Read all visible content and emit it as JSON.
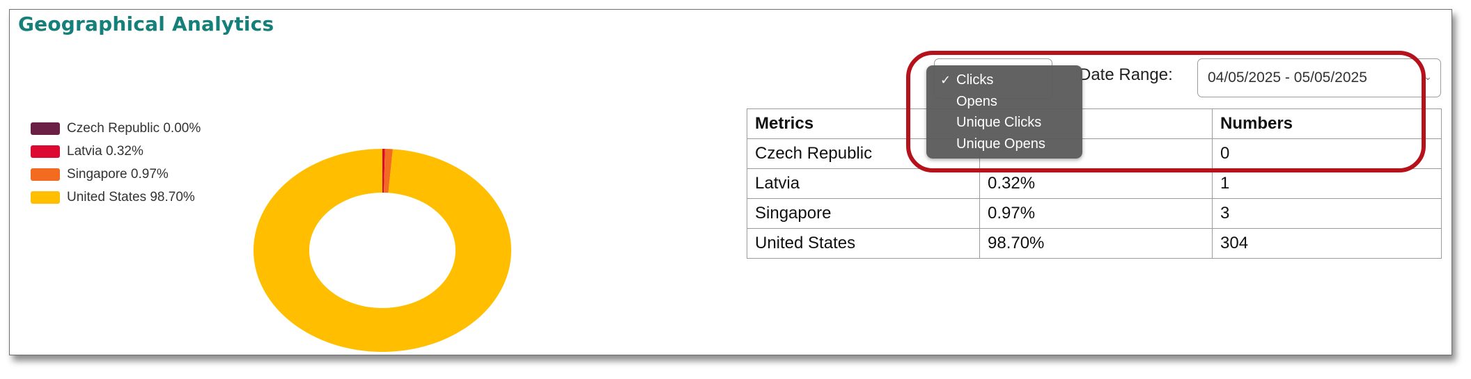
{
  "title": "Geographical Analytics",
  "legend": [
    {
      "label": "Czech Republic 0.00%",
      "color": "#6b1f45"
    },
    {
      "label": "Latvia 0.32%",
      "color": "#dc0a33"
    },
    {
      "label": "Singapore 0.97%",
      "color": "#f26b21"
    },
    {
      "label": "United States 98.70%",
      "color": "#ffbf00"
    }
  ],
  "chart_data": {
    "type": "pie",
    "categories": [
      "Czech Republic",
      "Latvia",
      "Singapore",
      "United States"
    ],
    "values": [
      0.0,
      0.32,
      0.97,
      98.7
    ],
    "colors": [
      "#6b1f45",
      "#dc0a33",
      "#f26b21",
      "#ffbf00"
    ],
    "style": "donut",
    "legend_position": "top-left"
  },
  "controls": {
    "date_range_label": "Date Range:",
    "date_range_value": "04/05/2025 - 05/05/2025"
  },
  "dropdown": {
    "options": [
      "Clicks",
      "Opens",
      "Unique Clicks",
      "Unique Opens"
    ],
    "selected": "Clicks",
    "check_mark": "✓"
  },
  "table": {
    "headers": [
      "Metrics",
      "",
      "Numbers"
    ],
    "rows": [
      [
        "Czech Republic",
        "",
        "0"
      ],
      [
        "Latvia",
        "0.32%",
        "1"
      ],
      [
        "Singapore",
        "0.97%",
        "3"
      ],
      [
        "United States",
        "98.70%",
        "304"
      ]
    ]
  },
  "highlight_color": "#b5121b"
}
